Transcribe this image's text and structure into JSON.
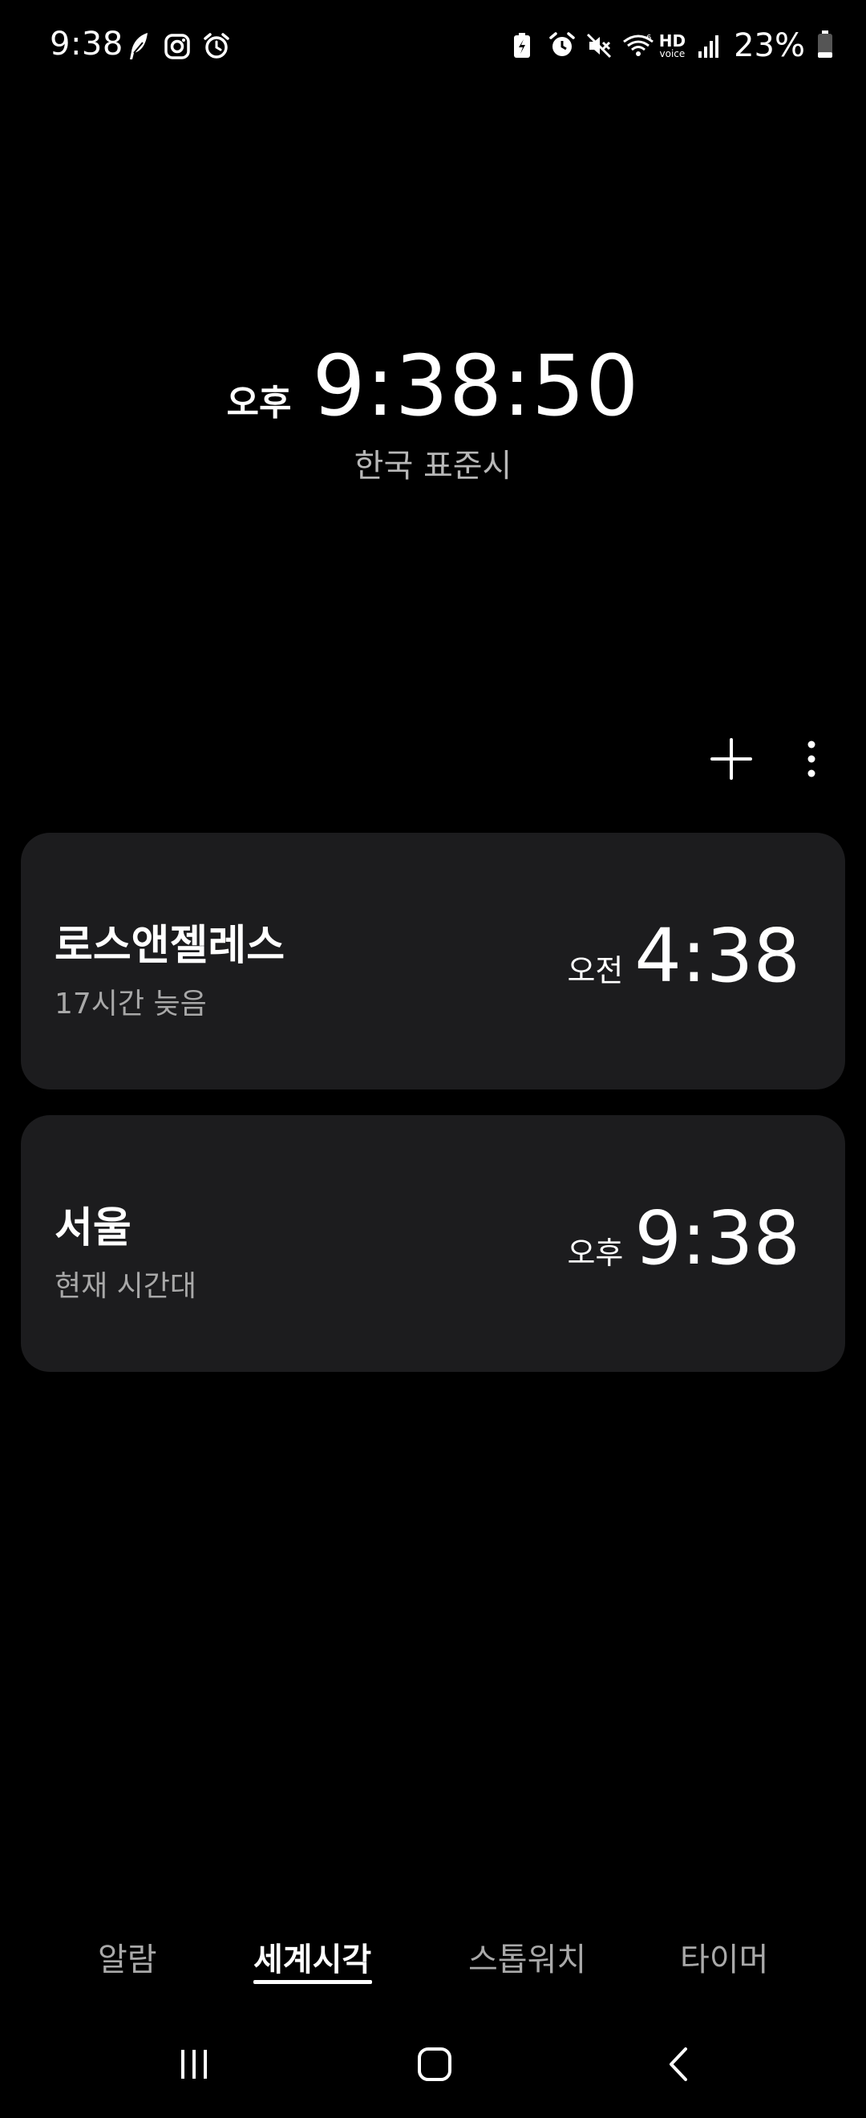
{
  "status_bar": {
    "time": "9:38",
    "left_icons": [
      "feather-icon",
      "instagram-icon",
      "alarm-clock-icon"
    ],
    "right_icons": [
      "battery-saver-icon",
      "alarm-icon",
      "mute-icon",
      "wifi-icon",
      "hd-voice-icon",
      "signal-icon"
    ],
    "hd_label": "HD",
    "voice_label": "voice",
    "battery_percent": "23%",
    "battery_level": 0.23
  },
  "main_clock": {
    "ampm": "오후",
    "time": "9:38:50",
    "timezone": "한국 표준시"
  },
  "actions": {
    "add_icon": "plus-icon",
    "more_icon": "more-vertical-icon"
  },
  "cities": [
    {
      "name": "로스앤젤레스",
      "subtitle": "17시간 늦음",
      "ampm": "오전",
      "time": "4:38"
    },
    {
      "name": "서울",
      "subtitle": "현재 시간대",
      "ampm": "오후",
      "time": "9:38"
    }
  ],
  "tabs": [
    {
      "label": "알람",
      "active": false
    },
    {
      "label": "세계시각",
      "active": true
    },
    {
      "label": "스톱워치",
      "active": false
    },
    {
      "label": "타이머",
      "active": false
    }
  ],
  "navbar": {
    "icons": [
      "recent-apps-icon",
      "home-icon",
      "back-icon"
    ]
  },
  "colors": {
    "background": "#000000",
    "card": "#1c1c1e",
    "text_primary": "#ffffff",
    "text_secondary": "#a8a8a8"
  }
}
